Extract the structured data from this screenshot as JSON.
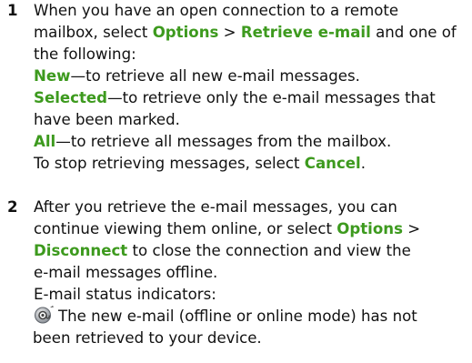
{
  "step1": {
    "number": "1",
    "l1": "When you have an open connection to a remote",
    "l2_a": "mailbox, select ",
    "options": "Options",
    "sep": " > ",
    "retrieve": "Retrieve e-mail",
    "l2_b": " and one of",
    "l3": "the following:",
    "new_kw": "New",
    "new_desc": "—to retrieve all new e-mail messages.",
    "selected_kw": "Selected",
    "selected_desc": "—to retrieve only the e-mail messages that",
    "selected_desc2": "have been marked.",
    "all_kw": "All",
    "all_desc": "—to retrieve all messages from the mailbox.",
    "stop_a": "To stop retrieving messages, select ",
    "cancel": "Cancel",
    "stop_b": "."
  },
  "step2": {
    "number": "2",
    "l1": "After you retrieve the e-mail messages, you can",
    "l2_a": "continue viewing them online, or select ",
    "options": "Options",
    "sep": " >",
    "disconnect": "Disconnect",
    "l3_b": " to close the connection and view the",
    "l4": "e-mail messages offline.",
    "indicators": "E-mail status indicators:",
    "icon_name": "new-email-not-retrieved-icon",
    "ind_l1": "The new e-mail (offline or online mode) has not",
    "ind_l2": "been retrieved to your device."
  },
  "colors": {
    "keyword": "#3d9a1e",
    "text": "#111111"
  }
}
